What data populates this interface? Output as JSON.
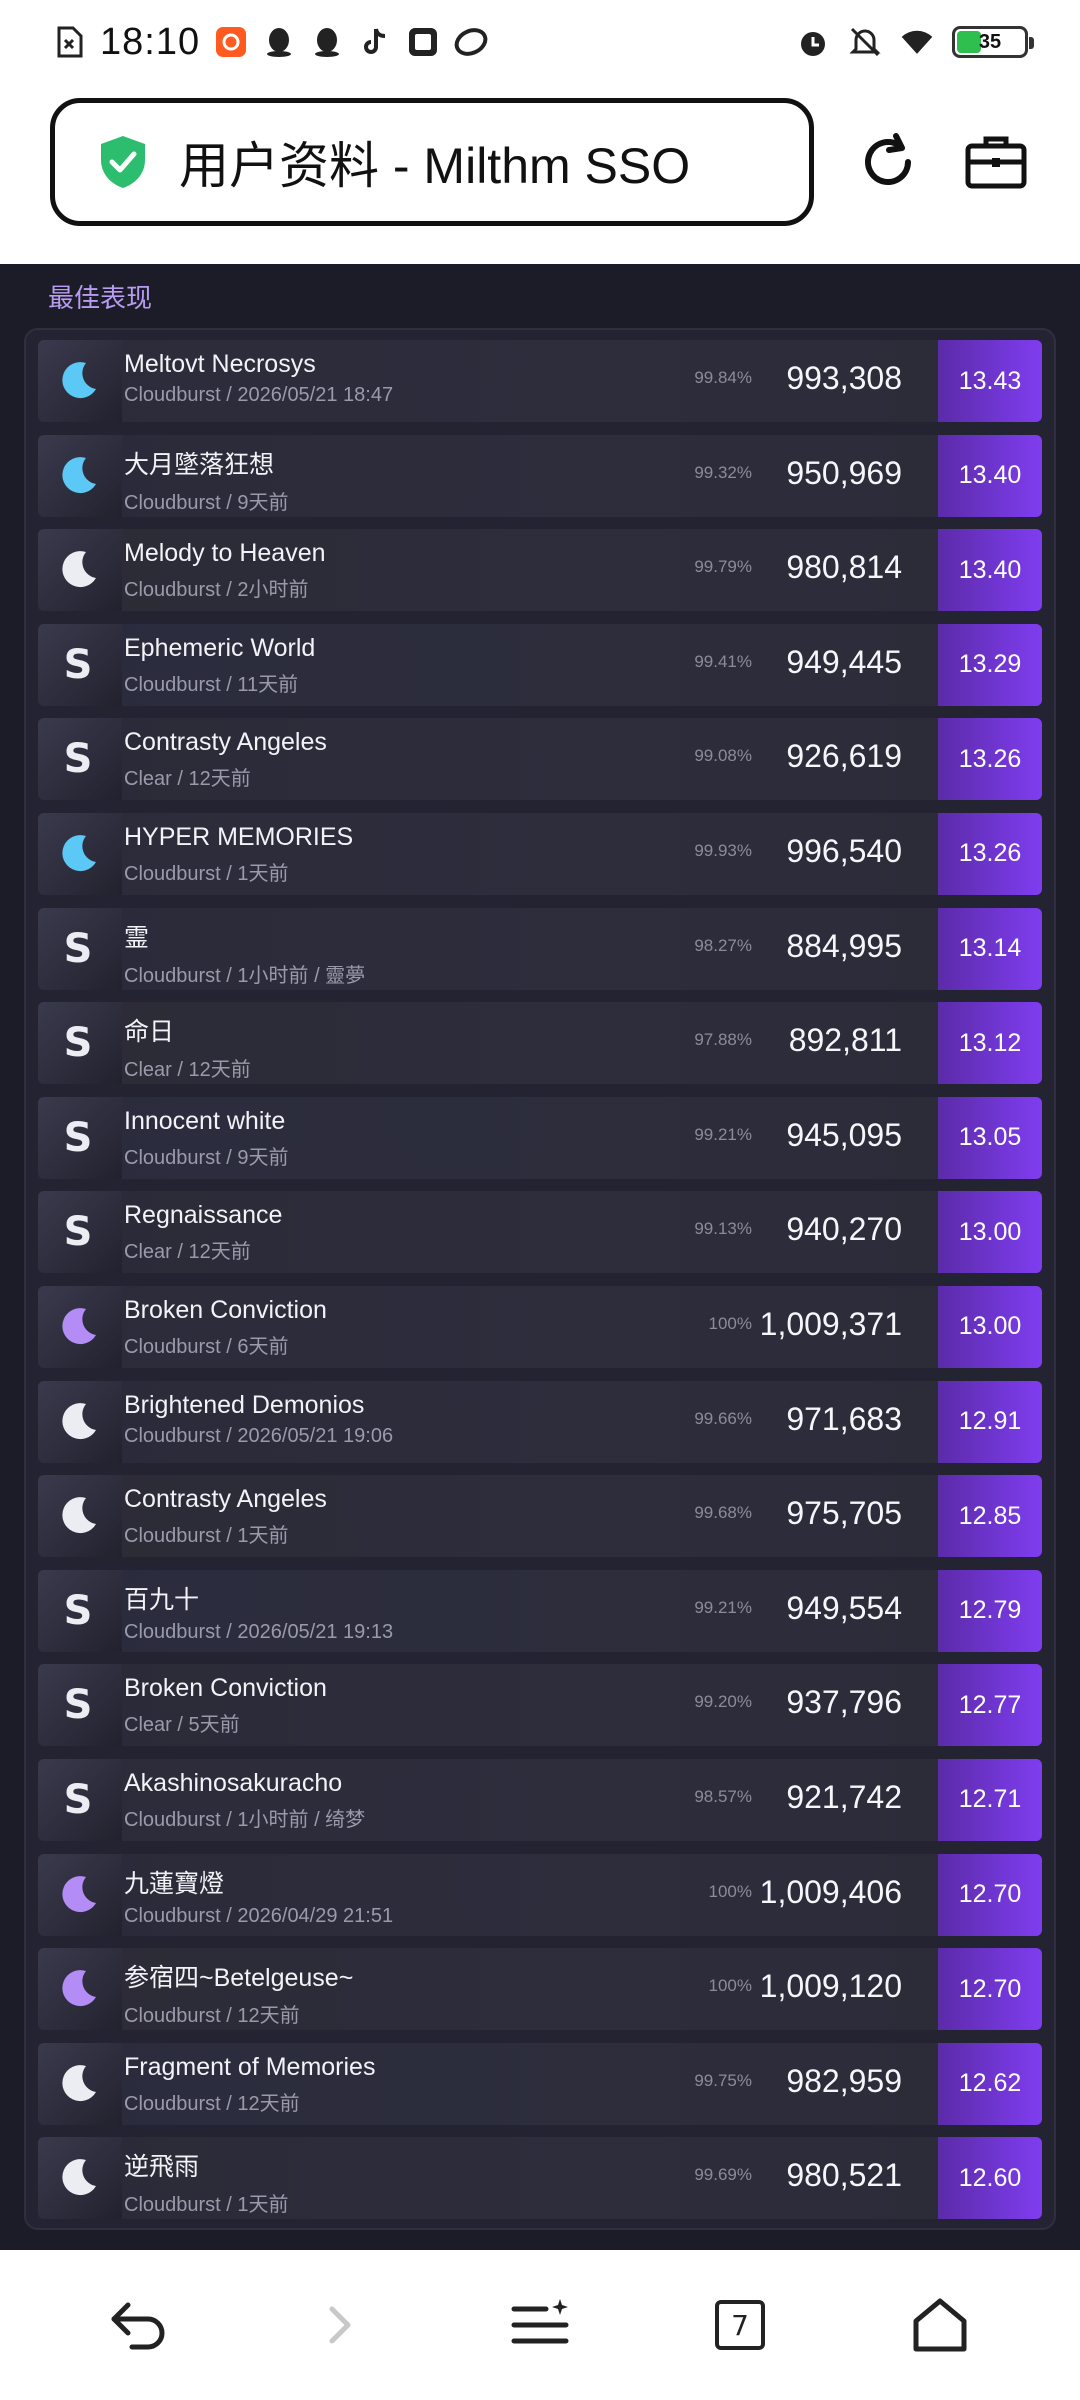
{
  "status_bar": {
    "time": "18:10",
    "battery": "35"
  },
  "url_bar": {
    "title": "用户资料 - Milthm SSO"
  },
  "section": {
    "title": "最佳表现"
  },
  "rows": [
    {
      "song": "Meltovt Necrosys",
      "sub": "Cloudburst / 2026/05/21 18:47",
      "acc": "99.84%",
      "score": "993,308",
      "rating": "13.43",
      "rank_icon": "moon-cyan"
    },
    {
      "song": "大月墜落狂想",
      "sub": "Cloudburst / 9天前",
      "acc": "99.32%",
      "score": "950,969",
      "rating": "13.40",
      "rank_icon": "moon-cyan"
    },
    {
      "song": "Melody to Heaven",
      "sub": "Cloudburst / 2小时前",
      "acc": "99.79%",
      "score": "980,814",
      "rating": "13.40",
      "rank_icon": "moon-white"
    },
    {
      "song": "Ephemeric World",
      "sub": "Cloudburst / 11天前",
      "acc": "99.41%",
      "score": "949,445",
      "rating": "13.29",
      "rank_icon": "s"
    },
    {
      "song": "Contrasty Angeles",
      "sub": "Clear / 12天前",
      "acc": "99.08%",
      "score": "926,619",
      "rating": "13.26",
      "rank_icon": "s"
    },
    {
      "song": "HYPER MEMORIES",
      "sub": "Cloudburst / 1天前",
      "acc": "99.93%",
      "score": "996,540",
      "rating": "13.26",
      "rank_icon": "moon-cyan"
    },
    {
      "song": "霊",
      "sub": "Cloudburst / 1小时前 / 靈夢",
      "acc": "98.27%",
      "score": "884,995",
      "rating": "13.14",
      "rank_icon": "s"
    },
    {
      "song": "命日",
      "sub": "Clear / 12天前",
      "acc": "97.88%",
      "score": "892,811",
      "rating": "13.12",
      "rank_icon": "s"
    },
    {
      "song": "Innocent white",
      "sub": "Cloudburst / 9天前",
      "acc": "99.21%",
      "score": "945,095",
      "rating": "13.05",
      "rank_icon": "s"
    },
    {
      "song": "Regnaissance",
      "sub": "Clear / 12天前",
      "acc": "99.13%",
      "score": "940,270",
      "rating": "13.00",
      "rank_icon": "s"
    },
    {
      "song": "Broken Conviction",
      "sub": "Cloudburst / 6天前",
      "acc": "100%",
      "score": "1,009,371",
      "rating": "13.00",
      "rank_icon": "moon-purple"
    },
    {
      "song": "Brightened Demonios",
      "sub": "Cloudburst / 2026/05/21 19:06",
      "acc": "99.66%",
      "score": "971,683",
      "rating": "12.91",
      "rank_icon": "moon-white"
    },
    {
      "song": "Contrasty Angeles",
      "sub": "Cloudburst / 1天前",
      "acc": "99.68%",
      "score": "975,705",
      "rating": "12.85",
      "rank_icon": "moon-white"
    },
    {
      "song": "百九十",
      "sub": "Cloudburst / 2026/05/21 19:13",
      "acc": "99.21%",
      "score": "949,554",
      "rating": "12.79",
      "rank_icon": "s"
    },
    {
      "song": "Broken Conviction",
      "sub": "Clear / 5天前",
      "acc": "99.20%",
      "score": "937,796",
      "rating": "12.77",
      "rank_icon": "s"
    },
    {
      "song": "Akashinosakuracho",
      "sub": "Cloudburst / 1小时前 / 绮梦",
      "acc": "98.57%",
      "score": "921,742",
      "rating": "12.71",
      "rank_icon": "s"
    },
    {
      "song": "九蓮寶燈",
      "sub": "Cloudburst / 2026/04/29 21:51",
      "acc": "100%",
      "score": "1,009,406",
      "rating": "12.70",
      "rank_icon": "moon-purple"
    },
    {
      "song": "参宿四~Betelgeuse~",
      "sub": "Cloudburst / 12天前",
      "acc": "100%",
      "score": "1,009,120",
      "rating": "12.70",
      "rank_icon": "moon-purple"
    },
    {
      "song": "Fragment of Memories",
      "sub": "Cloudburst / 12天前",
      "acc": "99.75%",
      "score": "982,959",
      "rating": "12.62",
      "rank_icon": "moon-white"
    },
    {
      "song": "逆飛雨",
      "sub": "Cloudburst / 1天前",
      "acc": "99.69%",
      "score": "980,521",
      "rating": "12.60",
      "rank_icon": "moon-white"
    }
  ],
  "nav": {
    "tab_count": "7"
  },
  "colors": {
    "accent": "#7f3df0",
    "page_bg": "#1c1c29",
    "moon_cyan": "#5cc8f5",
    "moon_purple": "#b38cf5",
    "moon_white": "#ececf3",
    "secure_green": "#2dbd6e"
  }
}
